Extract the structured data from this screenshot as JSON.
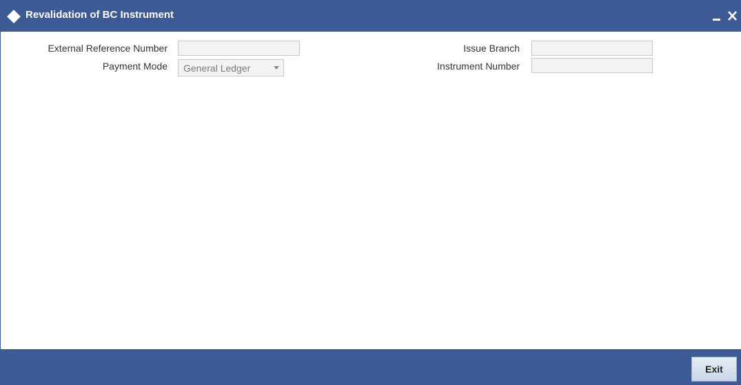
{
  "window": {
    "title": "Revalidation of BC Instrument"
  },
  "form": {
    "external_reference_number": {
      "label": "External Reference Number",
      "value": ""
    },
    "payment_mode": {
      "label": "Payment Mode",
      "value": "General Ledger"
    },
    "issue_branch": {
      "label": "Issue Branch",
      "value": ""
    },
    "instrument_number": {
      "label": "Instrument Number",
      "value": ""
    }
  },
  "footer": {
    "exit_label": "Exit"
  },
  "colors": {
    "header_bar": "#3d5a95",
    "field_bg": "#f3f3f3",
    "field_border": "#c8c8c8"
  },
  "icons": {
    "title": "diamond-icon",
    "minimize": "minimize-icon",
    "close": "close-icon",
    "dropdown": "chevron-down-icon"
  }
}
